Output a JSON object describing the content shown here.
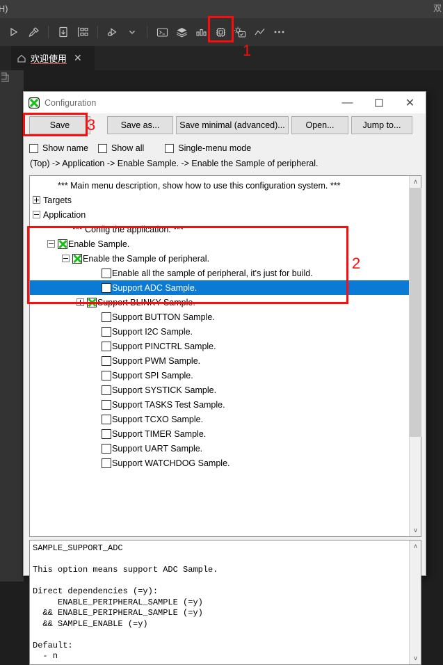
{
  "ide": {
    "menu_partial": "(H)",
    "title_right_partial": "双",
    "toolbar": {
      "items": [
        {
          "name": "run-icon",
          "glyph": "run"
        },
        {
          "name": "build-hammer-icon",
          "glyph": "hammer"
        },
        {
          "name": "download-file-icon",
          "glyph": "download"
        },
        {
          "name": "flowchart-icon",
          "glyph": "flowchart"
        },
        {
          "name": "debug-icon",
          "glyph": "debug"
        },
        {
          "name": "chevron-down-icon",
          "glyph": "chevron"
        },
        {
          "name": "terminal-icon",
          "glyph": "terminal"
        },
        {
          "name": "layers-icon",
          "glyph": "layers"
        },
        {
          "name": "bar-chart-icon",
          "glyph": "barchart"
        },
        {
          "name": "chip-icon",
          "glyph": "chip"
        },
        {
          "name": "config-gear-icon",
          "glyph": "gearpanel"
        },
        {
          "name": "line-chart-icon",
          "glyph": "linechart"
        },
        {
          "name": "more-actions-icon",
          "glyph": "ellipsis"
        }
      ]
    },
    "tab": {
      "label": "欢迎使用",
      "home_icon": "home-icon",
      "close_icon": "close-icon"
    },
    "activity_icon": "explorer-icon"
  },
  "dialog": {
    "app_icon": "green-x-icon",
    "title": "Configuration",
    "window_controls": {
      "minimize": "—",
      "maximize": "☐",
      "close": "✕"
    },
    "buttons": {
      "save": "Save",
      "save_as": "Save as...",
      "save_minimal": "Save minimal (advanced)...",
      "open": "Open...",
      "jump_to": "Jump to..."
    },
    "checkboxes": {
      "show_name": {
        "label": "Show name",
        "checked": false
      },
      "show_all": {
        "label": "Show all",
        "checked": false
      },
      "single_menu_mode": {
        "label": "Single-menu mode",
        "checked": false
      }
    },
    "breadcrumb": "(Top) -> Application -> Enable Sample. -> Enable the Sample of peripheral.",
    "tree": [
      {
        "indent": 1,
        "expander": "none",
        "checkbox": "none",
        "label": "*** Main menu description, show how to use this configuration system. ***",
        "selected": false
      },
      {
        "indent": 0,
        "expander": "plus",
        "checkbox": "none",
        "label": "Targets",
        "selected": false
      },
      {
        "indent": 0,
        "expander": "minus",
        "checkbox": "none",
        "label": "Application",
        "selected": false
      },
      {
        "indent": 2,
        "expander": "none",
        "checkbox": "none",
        "label": "*** Config the application. ***",
        "selected": false
      },
      {
        "indent": 1,
        "expander": "minus",
        "checkbox": "checked",
        "label": "Enable Sample.",
        "selected": false
      },
      {
        "indent": 2,
        "expander": "minus",
        "checkbox": "checked",
        "label": "Enable the Sample of peripheral.",
        "selected": false
      },
      {
        "indent": 4,
        "expander": "none",
        "checkbox": "unchecked",
        "label": "Enable all the sample of peripheral, it's just for build.",
        "selected": false
      },
      {
        "indent": 4,
        "expander": "none",
        "checkbox": "unchecked",
        "label": "Support ADC Sample.",
        "selected": true
      },
      {
        "indent": 3,
        "expander": "plus",
        "checkbox": "checked",
        "label": "Support BLINKY Sample.",
        "selected": false
      },
      {
        "indent": 4,
        "expander": "none",
        "checkbox": "unchecked",
        "label": "Support BUTTON Sample.",
        "selected": false
      },
      {
        "indent": 4,
        "expander": "none",
        "checkbox": "unchecked",
        "label": "Support I2C Sample.",
        "selected": false
      },
      {
        "indent": 4,
        "expander": "none",
        "checkbox": "unchecked",
        "label": "Support PINCTRL Sample.",
        "selected": false
      },
      {
        "indent": 4,
        "expander": "none",
        "checkbox": "unchecked",
        "label": "Support PWM Sample.",
        "selected": false
      },
      {
        "indent": 4,
        "expander": "none",
        "checkbox": "unchecked",
        "label": "Support SPI Sample.",
        "selected": false
      },
      {
        "indent": 4,
        "expander": "none",
        "checkbox": "unchecked",
        "label": "Support SYSTICK Sample.",
        "selected": false
      },
      {
        "indent": 4,
        "expander": "none",
        "checkbox": "unchecked",
        "label": "Support TASKS Test Sample.",
        "selected": false
      },
      {
        "indent": 4,
        "expander": "none",
        "checkbox": "unchecked",
        "label": "Support TCXO Sample.",
        "selected": false
      },
      {
        "indent": 4,
        "expander": "none",
        "checkbox": "unchecked",
        "label": "Support TIMER Sample.",
        "selected": false
      },
      {
        "indent": 4,
        "expander": "none",
        "checkbox": "unchecked",
        "label": "Support UART Sample.",
        "selected": false
      },
      {
        "indent": 4,
        "expander": "none",
        "checkbox": "unchecked",
        "label": "Support WATCHDOG Sample.",
        "selected": false
      }
    ],
    "help_text": "SAMPLE_SUPPORT_ADC\n\nThis option means support ADC Sample.\n\nDirect dependencies (=y):\n     ENABLE_PERIPHERAL_SAMPLE (=y)\n  && ENABLE_PERIPHERAL_SAMPLE (=y)\n  && SAMPLE_ENABLE (=y)\n\nDefault:\n  - n",
    "scrollbars": {
      "tree_up_arrow": "∧",
      "tree_down_arrow": "∨",
      "help_up_arrow": "∧",
      "help_down_arrow": "∨"
    }
  },
  "annotations": {
    "marker_1": "1",
    "marker_2": "2",
    "marker_3": "3",
    "color": "#fb0d0d"
  }
}
